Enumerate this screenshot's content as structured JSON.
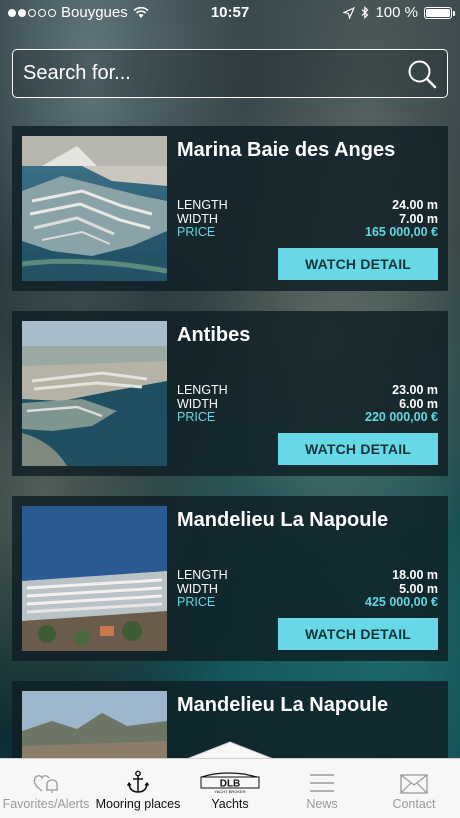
{
  "status_bar": {
    "carrier": "Bouygues",
    "time": "10:57",
    "battery": "100 %"
  },
  "search": {
    "placeholder": "Search for..."
  },
  "labels": {
    "length": "LENGTH",
    "width": "WIDTH",
    "price": "PRICE",
    "watch_detail": "WATCH DETAIL"
  },
  "listings": [
    {
      "title": "Marina Baie des Anges",
      "length": "24.00 m",
      "width": "7.00 m",
      "price": "165 000,00 €"
    },
    {
      "title": "Antibes",
      "length": "23.00 m",
      "width": "6.00 m",
      "price": "220 000,00 €"
    },
    {
      "title": "Mandelieu La Napoule",
      "length": "18.00 m",
      "width": "5.00 m",
      "price": "425 000,00 €"
    },
    {
      "title": "Mandelieu La Napoule"
    }
  ],
  "tabs": [
    {
      "label": "Favorites/Alerts",
      "icon": "heart-bell-icon"
    },
    {
      "label": "Mooring places",
      "icon": "anchor-icon"
    },
    {
      "label": "Yachts",
      "icon": "dlb-logo-icon",
      "active": true,
      "logo_text": "DLB",
      "logo_subtext": "YACHT BROKER"
    },
    {
      "label": "News",
      "icon": "menu-lines-icon"
    },
    {
      "label": "Contact",
      "icon": "envelope-icon"
    }
  ],
  "colors": {
    "accent": "#67d9e6",
    "price": "#5fd8e0",
    "tabbar": "#f7f7f7"
  }
}
